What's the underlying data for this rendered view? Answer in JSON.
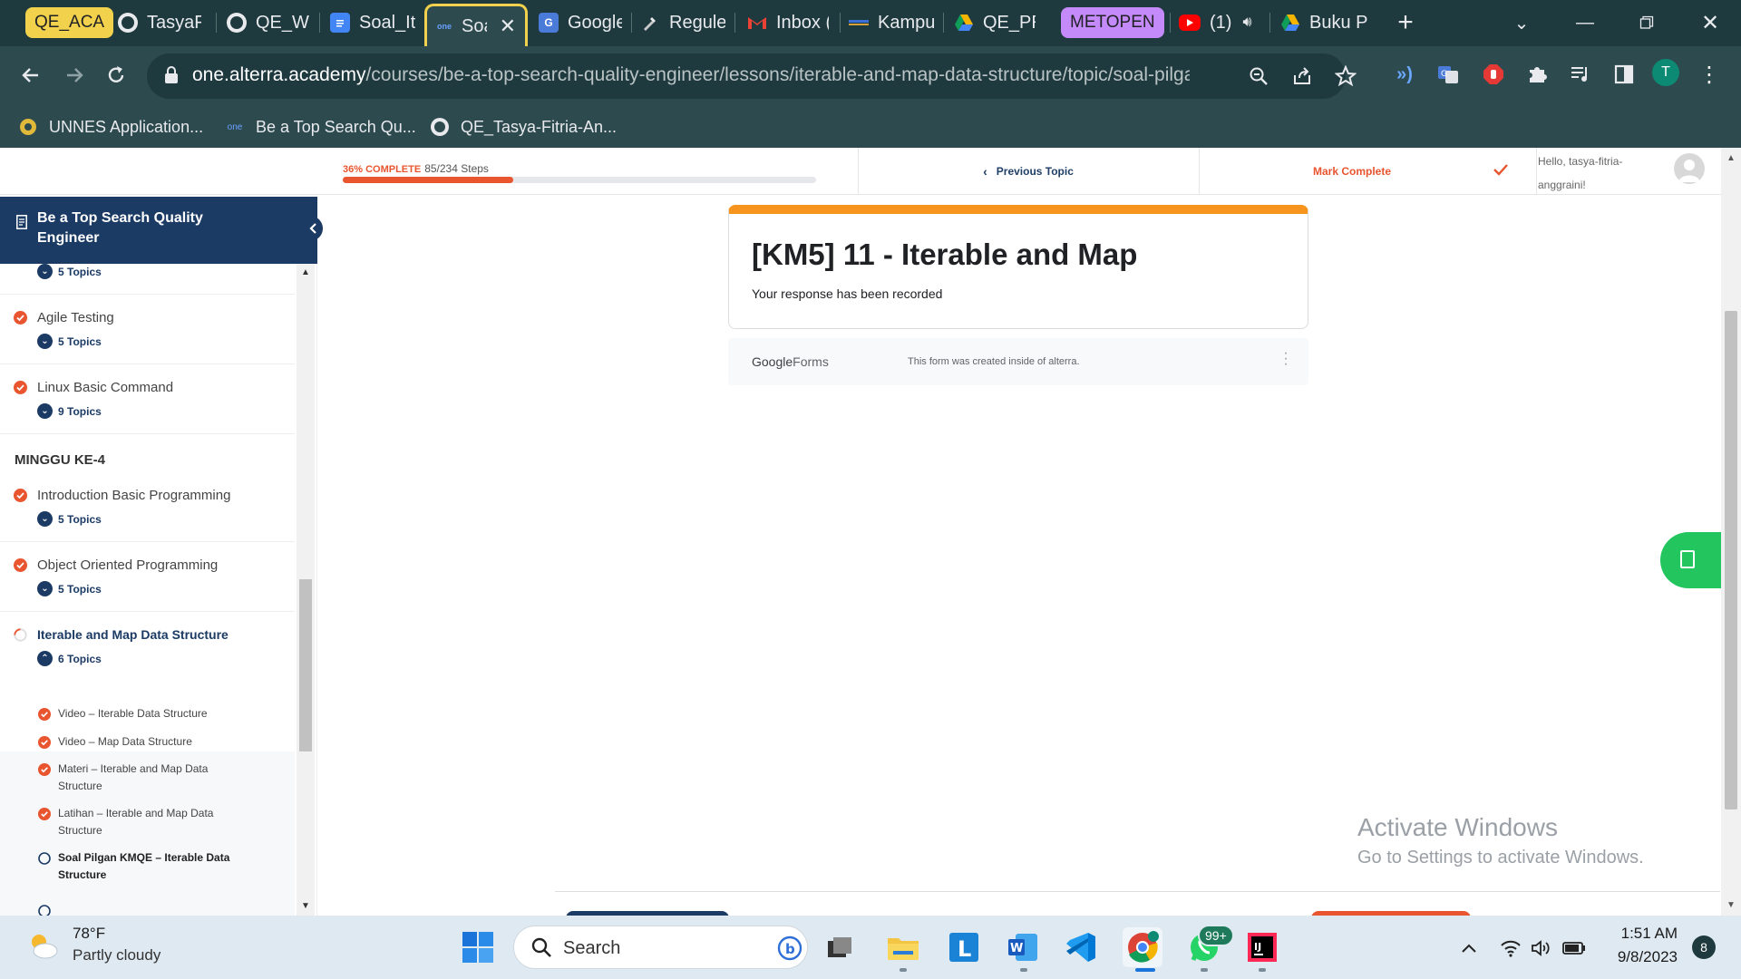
{
  "browser": {
    "tabs": [
      {
        "label": "QE_ACA",
        "icon": "group-label",
        "color": "#f2d14c"
      },
      {
        "label": "TasyaFi",
        "icon": "github-icon"
      },
      {
        "label": "QE_Wi",
        "icon": "github-icon"
      },
      {
        "label": "Soal_It",
        "icon": "google-docs-icon"
      },
      {
        "label": "Soa",
        "icon": "alterra-icon",
        "active": true
      },
      {
        "label": "Google",
        "icon": "google-translate-icon"
      },
      {
        "label": "Regule",
        "icon": "tool-icon"
      },
      {
        "label": "Inbox (",
        "icon": "gmail-icon"
      },
      {
        "label": "Kampu",
        "icon": "kampus-icon"
      },
      {
        "label": "QE_PR",
        "icon": "google-drive-icon"
      },
      {
        "label": "METOPEN",
        "icon": "group-label",
        "color": "#c58af9"
      },
      {
        "label": "(1)",
        "icon": "youtube-icon"
      },
      {
        "label": "Buku P",
        "icon": "google-drive-icon"
      }
    ],
    "url_host": "one.alterra.academy",
    "url_path": "/courses/be-a-top-search-quality-engineer/lessons/iterable-and-map-data-structure/topic/soal-pilgan...",
    "bookmarks": [
      {
        "label": "UNNES Application..."
      },
      {
        "label": "Be a Top Search Qu..."
      },
      {
        "label": "QE_Tasya-Fitria-An..."
      }
    ],
    "profile_initial": "T"
  },
  "topbar": {
    "progress_percent_label": "36% COMPLETE",
    "progress_steps": "85/234 Steps",
    "progress_value": 36,
    "previous_topic": "Previous Topic",
    "mark_complete": "Mark Complete",
    "greeting": "Hello, tasya-fitria-anggraini!"
  },
  "sidebar": {
    "course_title": "Be a Top Search Quality Engineer",
    "first_count": "5 Topics",
    "lessons": [
      {
        "title": "Agile Testing",
        "count": "5 Topics",
        "status": "complete"
      },
      {
        "title": "Linux Basic Command",
        "count": "9 Topics",
        "status": "complete"
      }
    ],
    "section": "MINGGU KE-4",
    "week4_lessons": [
      {
        "title": "Introduction Basic Programming",
        "count": "5 Topics",
        "status": "complete"
      },
      {
        "title": "Object Oriented Programming",
        "count": "5 Topics",
        "status": "complete"
      },
      {
        "title": "Iterable and Map Data Structure",
        "count": "6 Topics",
        "status": "in-progress"
      }
    ],
    "topics": [
      {
        "title": "Video – Iterable Data Structure",
        "status": "complete"
      },
      {
        "title": "Video – Map Data Structure",
        "status": "complete"
      },
      {
        "title": "Materi – Iterable and Map Data Structure",
        "status": "complete"
      },
      {
        "title": "Latihan – Iterable and Map Data Structure",
        "status": "complete"
      },
      {
        "title": "Soal Pilgan KMQE – Iterable Data Structure",
        "status": "current"
      }
    ]
  },
  "form": {
    "title": "[KM5] 11 - Iterable and Map",
    "response": "Your response has been recorded",
    "brand_google": "Google",
    "brand_forms": "Forms",
    "created_note": "This form was created inside of alterra."
  },
  "watermark": {
    "title": "Activate Windows",
    "subtitle": "Go to Settings to activate Windows."
  },
  "taskbar": {
    "weather_temp": "78°F",
    "weather_desc": "Partly cloudy",
    "search_placeholder": "Search",
    "whatsapp_badge": "99+",
    "time": "1:51 AM",
    "date": "9/8/2023",
    "notifications": "8"
  }
}
